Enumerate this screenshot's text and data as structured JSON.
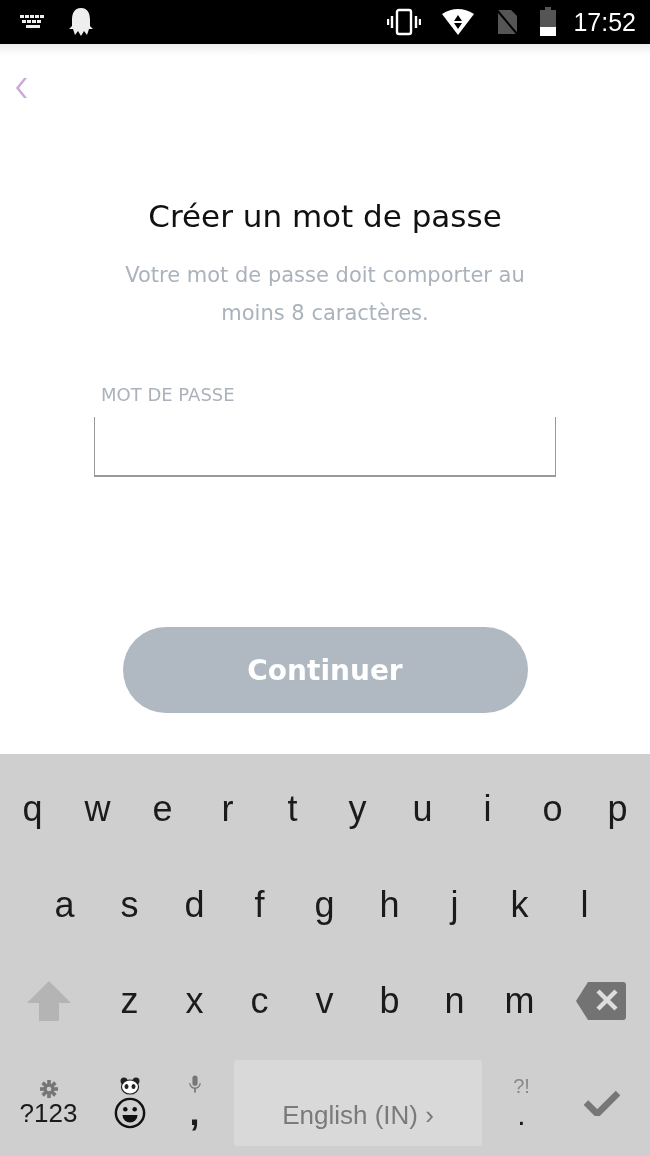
{
  "status_bar": {
    "time": "17:52"
  },
  "title": "Créer un mot de passe",
  "subtitle": "Votre mot de passe doit comporter au moins 8 caractères.",
  "password_field": {
    "label": "MOT DE PASSE",
    "disabled": false
  },
  "continue_button": {
    "label": "Continuer",
    "disabled": true
  },
  "keyboard": {
    "rows": [
      [
        "q",
        "w",
        "e",
        "r",
        "t",
        "y",
        "u",
        "i",
        "o",
        "p"
      ],
      [
        "a",
        "s",
        "d",
        "f",
        "g",
        "h",
        "j",
        "k",
        "l"
      ],
      [
        "z",
        "x",
        "c",
        "v",
        "b",
        "n",
        "m"
      ]
    ],
    "symbols_key": "?123",
    "comma_key": ",",
    "space_key": "English (IN) ›",
    "punctuation_hint": "?!",
    "period_key": "."
  }
}
